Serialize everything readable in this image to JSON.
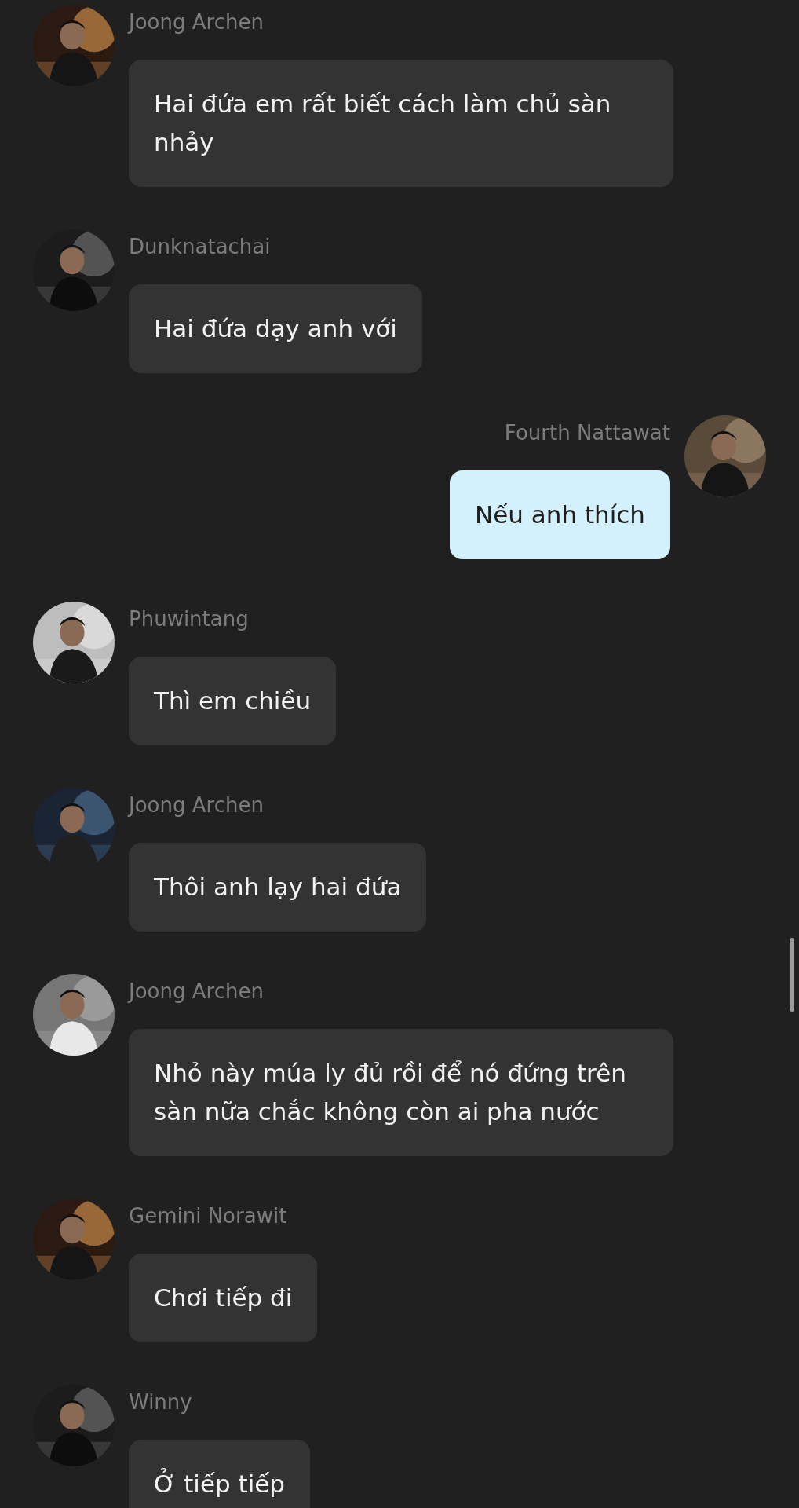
{
  "messages": [
    {
      "kind": "received",
      "sender": "Joong Archen",
      "text": "Hai đứa em rất biết cách làm chủ sàn nhảy"
    },
    {
      "kind": "received",
      "sender": "Dunknatachai",
      "text": "Hai đứa dạy anh với"
    },
    {
      "kind": "sent",
      "sender": "Fourth Nattawat",
      "text": "Nếu anh thích"
    },
    {
      "kind": "received",
      "sender": "Phuwintang",
      "text": "Thì em chiều"
    },
    {
      "kind": "received",
      "sender": "Joong Archen",
      "text": "Thôi anh lạy hai đứa"
    },
    {
      "kind": "received",
      "sender": "Joong Archen",
      "text": "Nhỏ này múa ly đủ rồi để nó đứng trên sàn nữa chắc không còn ai pha nước"
    },
    {
      "kind": "received",
      "sender": "Gemini Norawit",
      "text": "Chơi tiếp đi"
    },
    {
      "kind": "received",
      "sender": "Winny",
      "text": "Ở tiếp tiếp"
    }
  ]
}
